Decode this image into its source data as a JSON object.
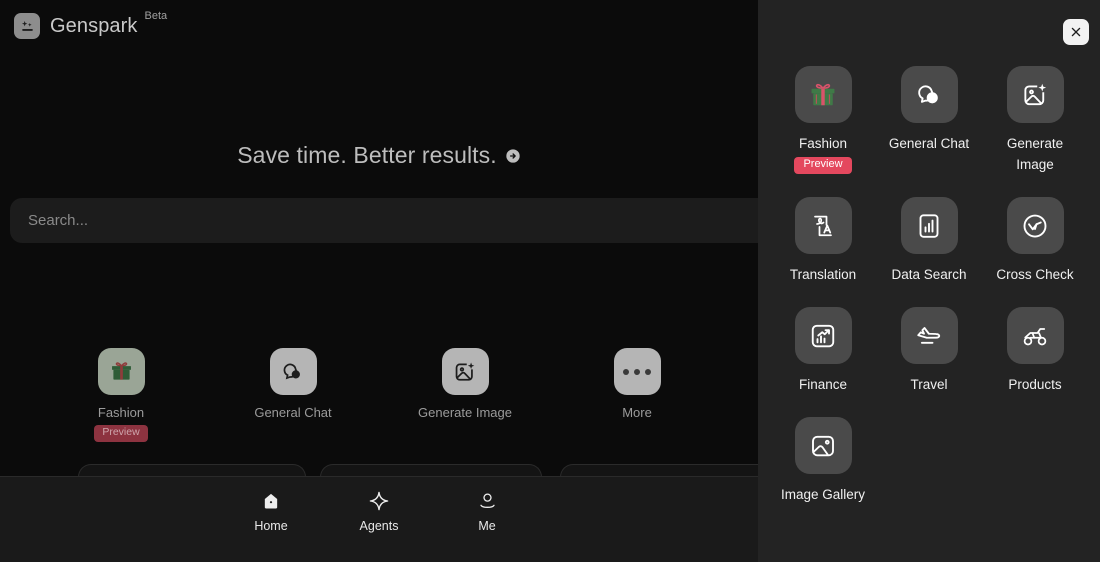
{
  "header": {
    "logo_icon": "genspark-sparkle-logo",
    "brand": "Genspark",
    "beta_tag": "Beta"
  },
  "hero": {
    "headline": "Save time. Better results.",
    "headline_arrow_icon": "arrow-right-circle-icon"
  },
  "search": {
    "placeholder": "Search...",
    "value": ""
  },
  "quick_actions": [
    {
      "label": "Fashion",
      "icon": "gift-box-icon",
      "badge": "Preview"
    },
    {
      "label": "General Chat",
      "icon": "chat-bubbles-icon",
      "badge": ""
    },
    {
      "label": "Generate Image",
      "icon": "image-sparkle-icon",
      "badge": ""
    },
    {
      "label": "More",
      "icon": "ellipsis-icon",
      "badge": ""
    }
  ],
  "bottom_nav": [
    {
      "label": "Home",
      "icon": "home-icon",
      "active": true
    },
    {
      "label": "Agents",
      "icon": "sparkle-star-icon",
      "active": false
    },
    {
      "label": "Me",
      "icon": "person-icon",
      "active": false
    }
  ],
  "panel": {
    "ghost_title": "",
    "close_icon": "close-icon",
    "items": [
      {
        "label": "Fashion",
        "icon": "gift-box-icon",
        "badge": "Preview"
      },
      {
        "label": "General Chat",
        "icon": "chat-bubbles-icon",
        "badge": ""
      },
      {
        "label": "Generate Image",
        "icon": "image-sparkle-icon",
        "badge": ""
      },
      {
        "label": "Translation",
        "icon": "translate-icon",
        "badge": ""
      },
      {
        "label": "Data Search",
        "icon": "bar-chart-icon",
        "badge": ""
      },
      {
        "label": "Cross Check",
        "icon": "double-check-circle-icon",
        "badge": ""
      },
      {
        "label": "Finance",
        "icon": "finance-chart-icon",
        "badge": ""
      },
      {
        "label": "Travel",
        "icon": "airplane-takeoff-icon",
        "badge": ""
      },
      {
        "label": "Products",
        "icon": "atv-quad-bike-icon",
        "badge": ""
      },
      {
        "label": "Image Gallery",
        "icon": "image-gallery-icon",
        "badge": ""
      }
    ]
  },
  "colors": {
    "app_background": "#0b0b0b",
    "panel_background": "#232323",
    "tile_background": "#4a4a4a",
    "badge_red": "#e4485e",
    "close_button": "#f2f2f2",
    "text_primary": "#f0f0f0",
    "text_muted": "#9b9b9b"
  }
}
